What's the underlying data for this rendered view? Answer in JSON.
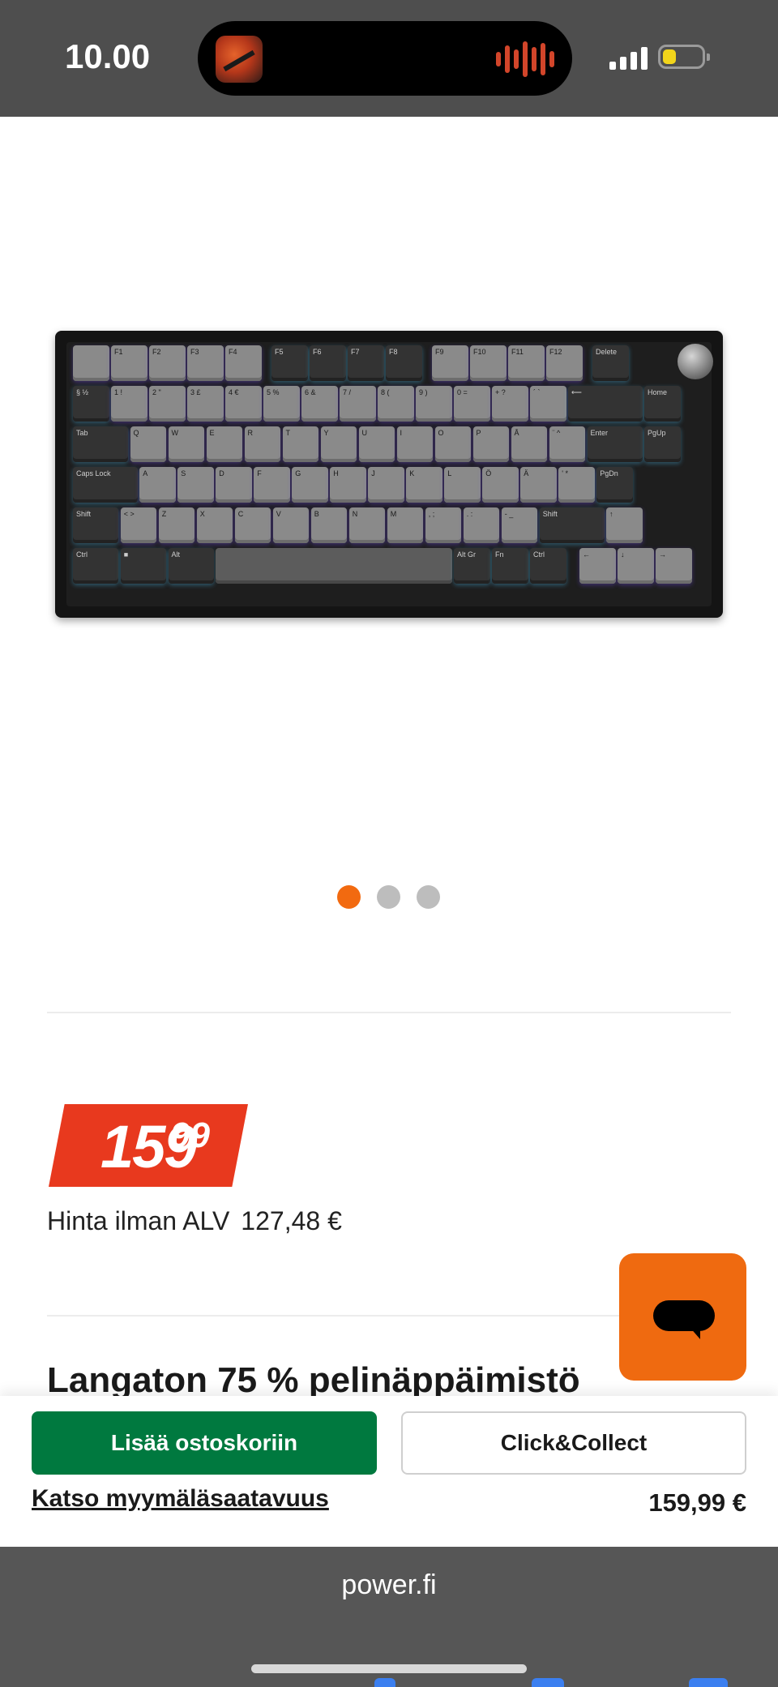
{
  "status_bar": {
    "time": "10.00",
    "battery_level": 0.35,
    "battery_color": "#f2d51b",
    "signal_bars": 4
  },
  "product": {
    "image_alt": "Langaton 75 % pelinäppäimistö",
    "carousel": {
      "count": 3,
      "active_index": 0
    },
    "keyboard_rows": [
      [
        "",
        "F1",
        "F2",
        "F3",
        "F4",
        "F5",
        "F6",
        "F7",
        "F8",
        "F9",
        "F10",
        "F11",
        "F12",
        "Delete"
      ],
      [
        "§ ½",
        "1 !",
        "2 \"",
        "3 £",
        "4 €",
        "5 %",
        "6 &",
        "7 /",
        "8 (",
        "9 )",
        "0 =",
        "+ ?",
        "´ `",
        "⟵",
        "Home"
      ],
      [
        "Tab",
        "Q",
        "W",
        "E",
        "R",
        "T",
        "Y",
        "U",
        "I",
        "O",
        "P",
        "Å",
        "¨ ^",
        "Enter",
        "PgUp"
      ],
      [
        "Caps Lock",
        "A",
        "S",
        "D",
        "F",
        "G",
        "H",
        "J",
        "K",
        "L",
        "Ö",
        "Ä",
        "' *",
        "PgDn"
      ],
      [
        "Shift",
        "< >",
        "Z",
        "X",
        "C",
        "V",
        "B",
        "N",
        "M",
        ", ;",
        ". :",
        "- _",
        "Shift",
        "↑"
      ],
      [
        "Ctrl",
        "■",
        "Alt",
        "",
        "Alt Gr",
        "Fn",
        "Ctrl",
        "←",
        "↓",
        "→"
      ]
    ],
    "price": {
      "main": "159",
      "cents": "99",
      "vat_label": "Hinta ilman ALV",
      "vat_value": "127,48 €"
    },
    "title": "Langaton 75 % pelinäppäimistö"
  },
  "chat": {
    "icon": "chat-bubble-icon",
    "color": "#ef6a10"
  },
  "sticky": {
    "add_to_cart": "Lisää ostoskoriin",
    "click_collect": "Click&Collect",
    "store_availability": "Katso myymäläsaatavuus",
    "price": "159,99 €"
  },
  "browser": {
    "url": "power.fi"
  },
  "colors": {
    "accent": "#f26a10",
    "price_tag": "#e8391e",
    "cart_button": "#00793f"
  }
}
